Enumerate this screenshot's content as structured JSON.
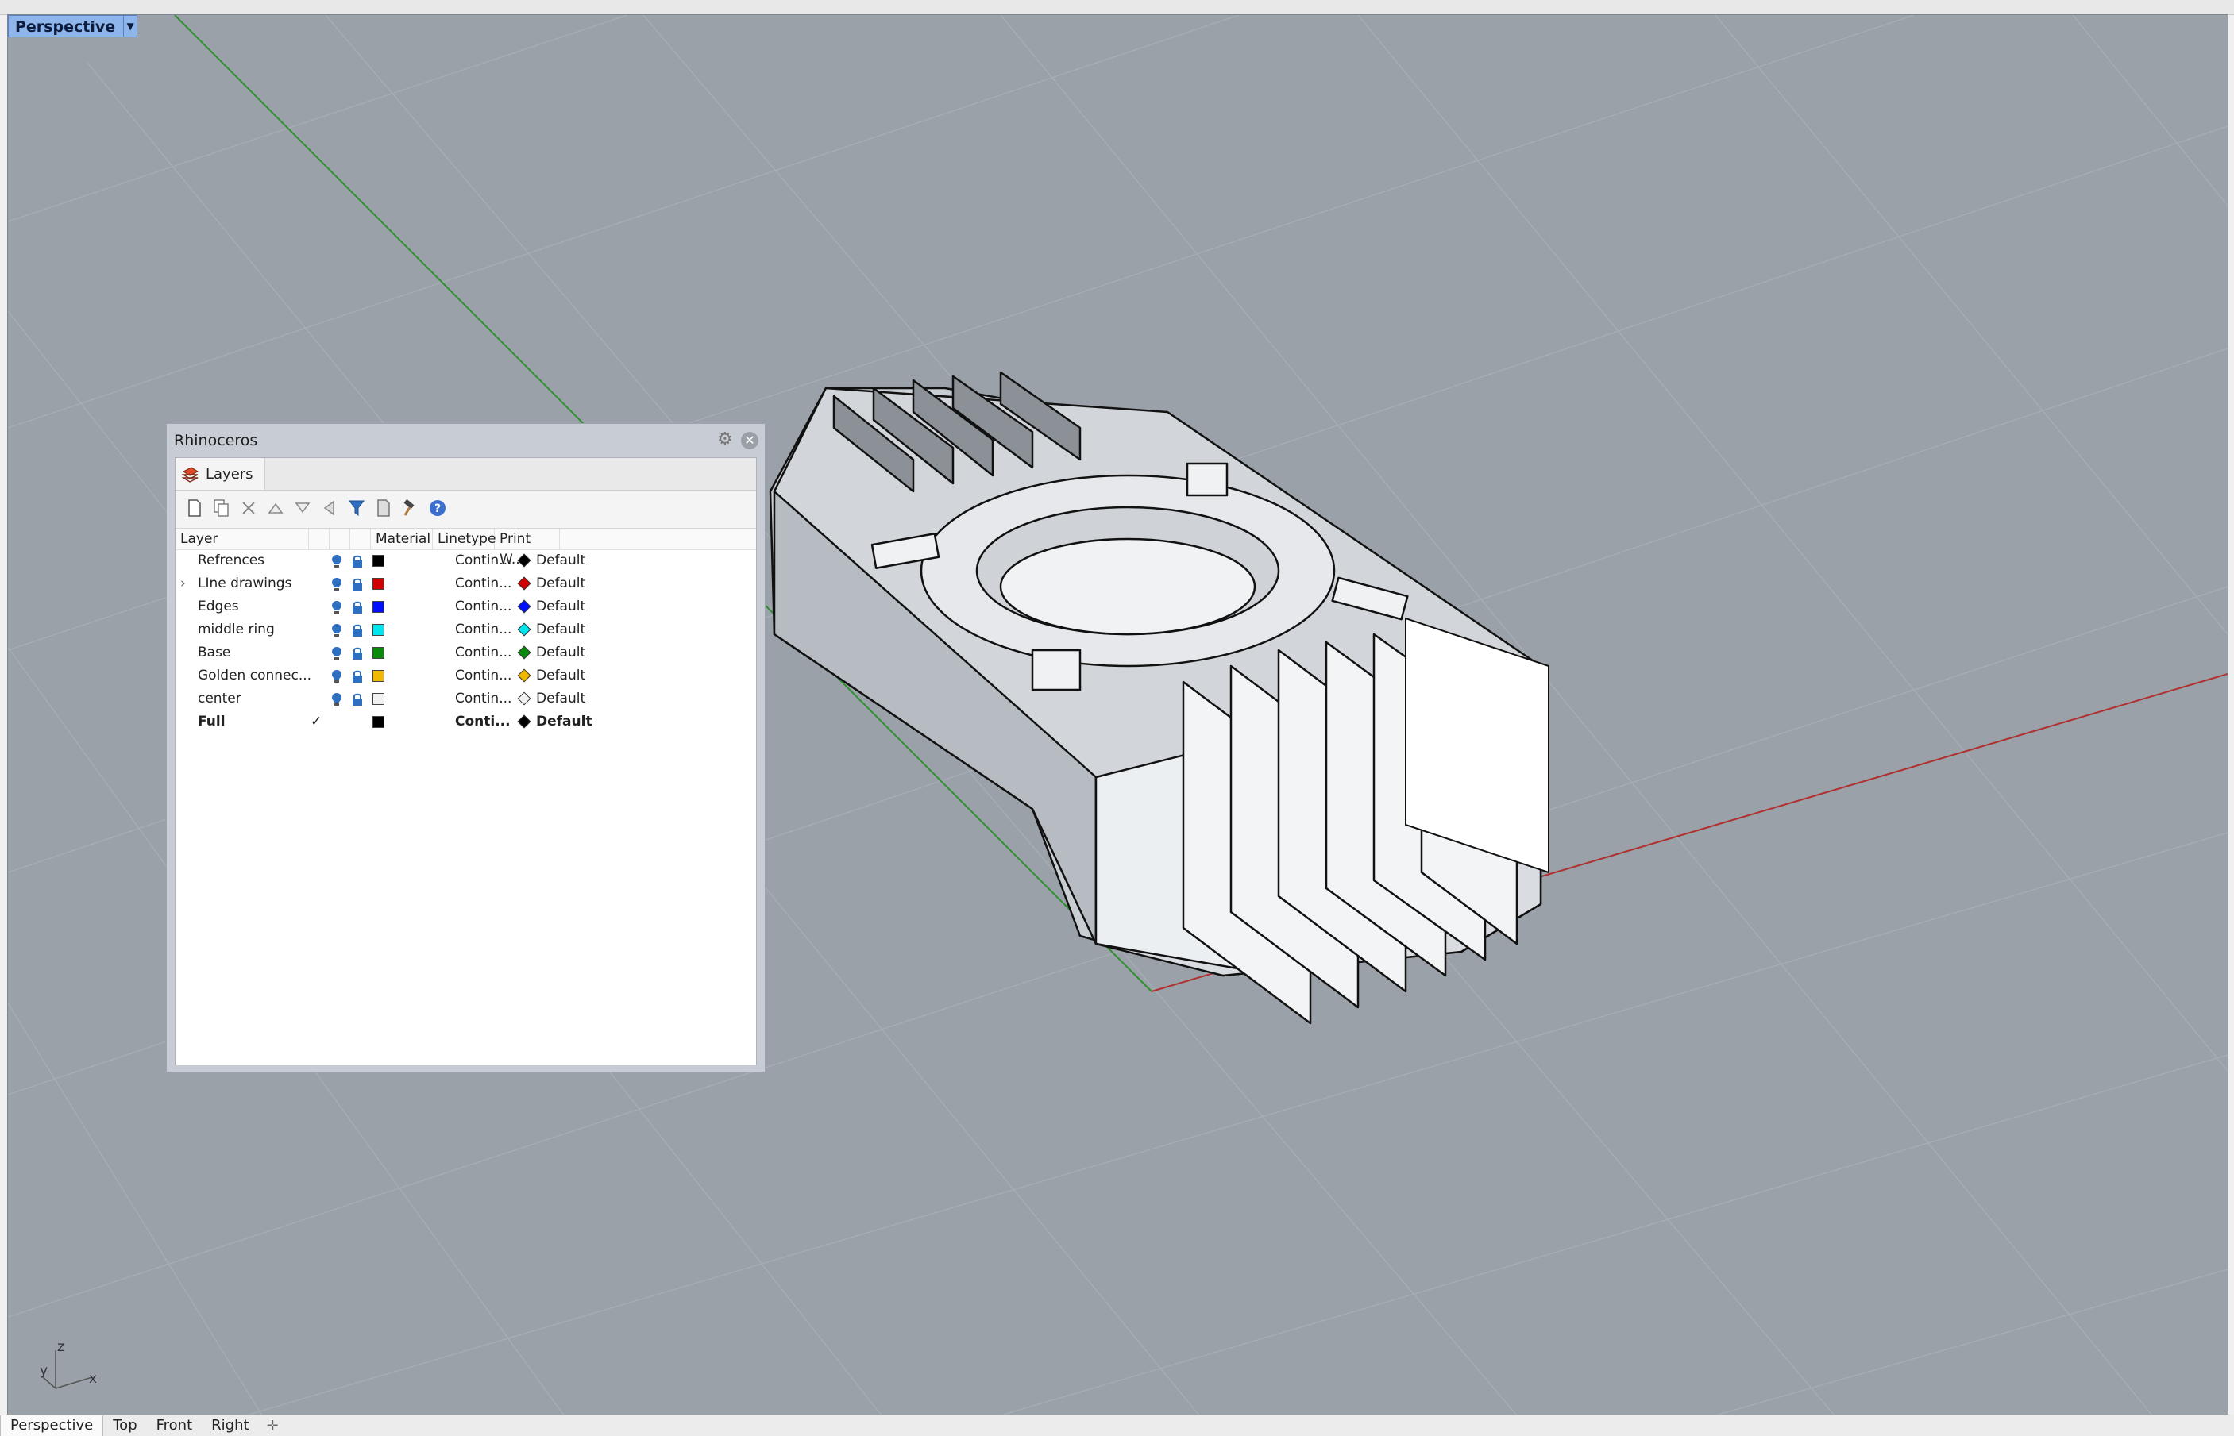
{
  "viewport": {
    "active_name": "Perspective",
    "axis_labels": {
      "z": "z",
      "y": "y",
      "x": "x"
    }
  },
  "bottom_tabs": [
    {
      "label": "Perspective",
      "active": true
    },
    {
      "label": "Top",
      "active": false
    },
    {
      "label": "Front",
      "active": false
    },
    {
      "label": "Right",
      "active": false
    }
  ],
  "panel": {
    "title": "Rhinoceros",
    "tab_label": "Layers",
    "columns": {
      "layer": "Layer",
      "material": "Material",
      "linetype": "Linetype",
      "print_width": "Print W..."
    },
    "layers": [
      {
        "name": "Refrences",
        "color": "#000000",
        "linetype": "Contin...",
        "print_width": "Default",
        "current": false,
        "expandable": false
      },
      {
        "name": "LIne drawings",
        "color": "#d00000",
        "linetype": "Contin...",
        "print_width": "Default",
        "current": false,
        "expandable": true
      },
      {
        "name": "Edges",
        "color": "#0010ff",
        "linetype": "Contin...",
        "print_width": "Default",
        "current": false,
        "expandable": false
      },
      {
        "name": "middle ring",
        "color": "#00e5ee",
        "linetype": "Contin...",
        "print_width": "Default",
        "current": false,
        "expandable": false
      },
      {
        "name": "Base",
        "color": "#0a8a0a",
        "linetype": "Contin...",
        "print_width": "Default",
        "current": false,
        "expandable": false
      },
      {
        "name": "Golden connec...",
        "color": "#f0b800",
        "linetype": "Contin...",
        "print_width": "Default",
        "current": false,
        "expandable": false
      },
      {
        "name": "center",
        "color": "#f2f2f2",
        "linetype": "Contin...",
        "print_width": "Default",
        "current": false,
        "expandable": false
      },
      {
        "name": "Full",
        "color": "#000000",
        "linetype": "Conti...",
        "print_width": "Default",
        "current": true,
        "expandable": false
      }
    ],
    "colors": {
      "bulb": "#2f6fbf",
      "lock": "#2f6fbf"
    }
  }
}
